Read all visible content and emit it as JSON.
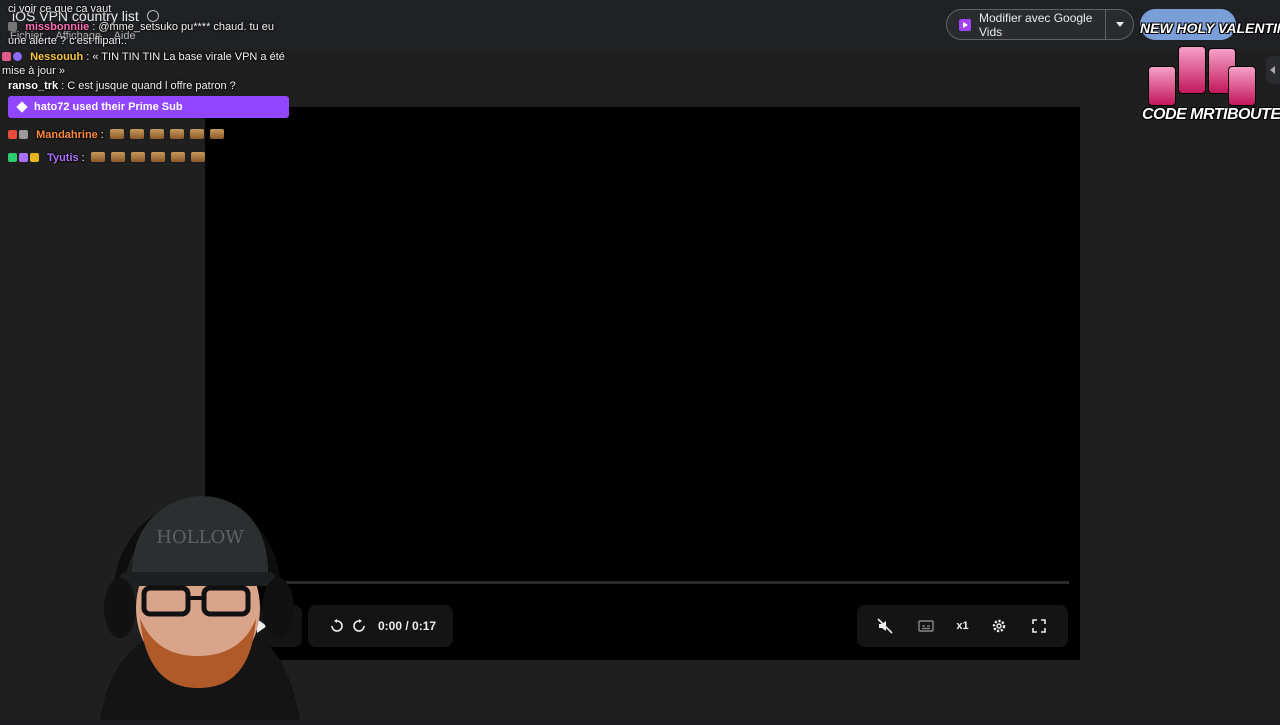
{
  "drive": {
    "file_title": "iOS VPN country list",
    "subnav": [
      "Fichier",
      "Affichage",
      "Aide"
    ],
    "google_vids_label": "Modifier avec Google Vids"
  },
  "player": {
    "time": "0:00 / 0:17",
    "speed": "x1",
    "progress_fraction": 0.0
  },
  "chat": {
    "messages": [
      {
        "user": "",
        "text": "ci voir ce que ca vaut",
        "user_color": "#ffffff"
      },
      {
        "user": "missbonniie",
        "text": "@mme_setsuko pu**** chaud. tu eu une alerte ? c'est flipan..",
        "user_color": "#ff6fb5"
      },
      {
        "user": "Nessouuh",
        "text": "« TIN TIN TIN La base virale VPN a été mise à jour »",
        "user_color": "#f5c542"
      },
      {
        "user": "ranso_trk",
        "text": "C est jusque quand l offre patron ?",
        "user_color": "#ffffff"
      },
      {
        "user": "Mandahrine",
        "text": "",
        "user_color": "#ff8a3d"
      },
      {
        "user": "Tyutis",
        "text": "",
        "user_color": "#a970ff"
      }
    ],
    "prime_sub": "hato72 used their Prime Sub"
  },
  "sponsor": {
    "title": "NEW HOLY VALENTINE",
    "code": "CODE MRTIBOUTE"
  }
}
